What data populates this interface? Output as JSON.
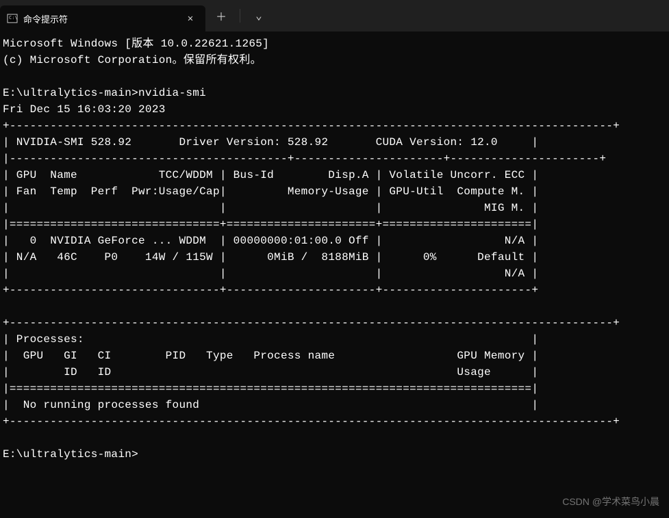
{
  "tab": {
    "title": "命令提示符",
    "icon": "terminal-icon"
  },
  "actions": {
    "close": "✕",
    "add": "＋",
    "dropdown": "⌄"
  },
  "term": {
    "line1": "Microsoft Windows [版本 10.0.22621.1265]",
    "line2": "(c) Microsoft Corporation。保留所有权利。",
    "line3": "",
    "line4": "E:\\ultralytics-main>nvidia-smi",
    "line5": "Fri Dec 15 16:03:20 2023",
    "hr1": "+-----------------------------------------------------------------------------------------+",
    "ver": "| NVIDIA-SMI 528.92       Driver Version: 528.92       CUDA Version: 12.0     |",
    "sep1": "|-----------------------------------------+----------------------+----------------------+",
    "hdr1": "| GPU  Name            TCC/WDDM | Bus-Id        Disp.A | Volatile Uncorr. ECC |",
    "hdr2": "| Fan  Temp  Perf  Pwr:Usage/Cap|         Memory-Usage | GPU-Util  Compute M. |",
    "hdr3": "|                               |                      |               MIG M. |",
    "sep2": "|===============================+======================+======================|",
    "gpu1": "|   0  NVIDIA GeForce ... WDDM  | 00000000:01:00.0 Off |                  N/A |",
    "gpu2": "| N/A   46C    P0    14W / 115W |      0MiB /  8188MiB |      0%      Default |",
    "gpu3": "|                               |                      |                  N/A |",
    "hr2": "+-------------------------------+----------------------+----------------------+",
    "blank": "",
    "hr3": "+-----------------------------------------------------------------------------------------+",
    "proc1": "| Processes:                                                                  |",
    "proc2": "|  GPU   GI   CI        PID   Type   Process name                  GPU Memory |",
    "proc3": "|        ID   ID                                                   Usage      |",
    "sep3": "|=============================================================================|",
    "proc4": "|  No running processes found                                                 |",
    "hr4": "+-----------------------------------------------------------------------------------------+",
    "blank2": "",
    "prompt": "E:\\ultralytics-main>"
  },
  "watermark": "CSDN @学术菜鸟小晨"
}
